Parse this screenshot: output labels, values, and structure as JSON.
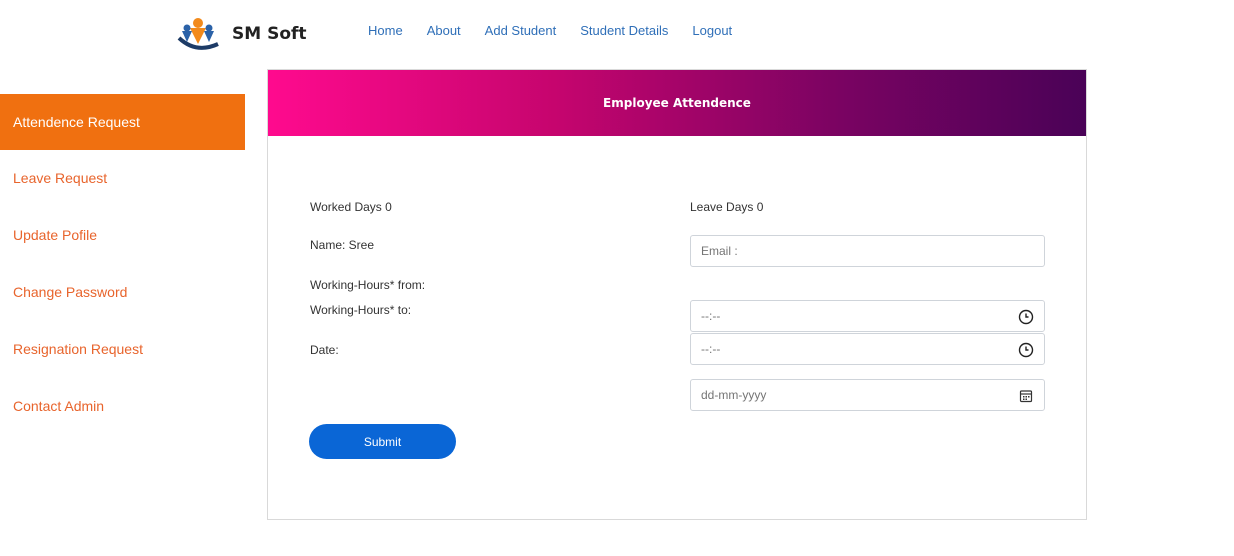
{
  "header": {
    "brand": "SM Soft",
    "nav": [
      "Home",
      "About",
      "Add Student",
      "Student Details",
      "Logout"
    ]
  },
  "sidebar": {
    "items": [
      {
        "label": "Attendence Request",
        "active": true
      },
      {
        "label": "Leave Request",
        "active": false
      },
      {
        "label": "Update Pofile",
        "active": false
      },
      {
        "label": "Change Password",
        "active": false
      },
      {
        "label": "Resignation Request",
        "active": false
      },
      {
        "label": "Contact Admin",
        "active": false
      }
    ]
  },
  "card": {
    "title": "Employee Attendence",
    "worked_days": "Worked Days 0",
    "leave_days": "Leave Days 0",
    "name": "Name: Sree",
    "hours_from_label": "Working-Hours* from:",
    "hours_to_label": "Working-Hours* to:",
    "date_label": "Date:",
    "email_placeholder": "Email :",
    "time_from_placeholder": "--:--",
    "time_to_placeholder": "--:--",
    "date_placeholder": "dd-mm-yyyy",
    "submit_label": "Submit"
  },
  "colors": {
    "nav_link": "#2f6fb8",
    "sidebar_text": "#e8642c",
    "sidebar_active_bg": "#f07010",
    "header_gradient_start": "#ff0a8e",
    "header_gradient_end": "#4a0257",
    "submit_bg": "#0a66d6"
  },
  "icons": {
    "logo": "sm-soft-logo",
    "time": "clock-icon",
    "date": "calendar-icon"
  }
}
